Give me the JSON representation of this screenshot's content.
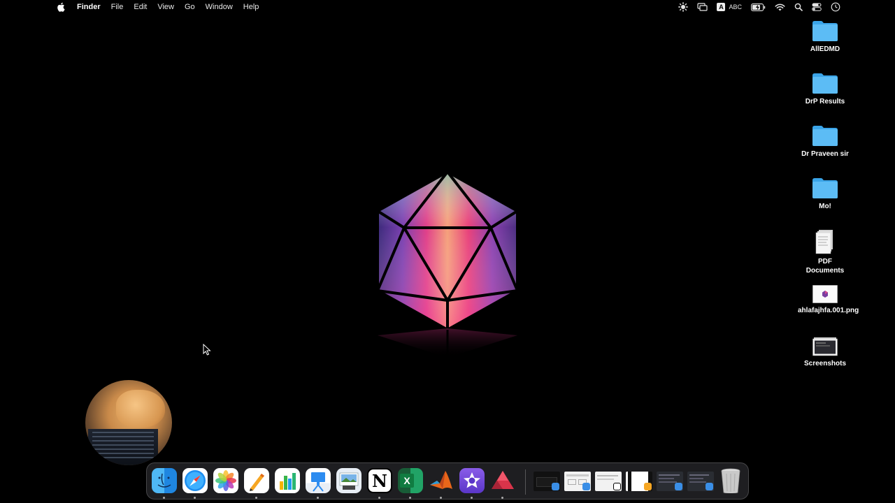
{
  "menubar": {
    "apple_icon": "apple-logo-icon",
    "app_name": "Finder",
    "items": [
      "File",
      "Edit",
      "View",
      "Go",
      "Window",
      "Help"
    ],
    "status": {
      "icons": [
        "brightness-icon",
        "screen-mirroring-icon",
        "input-source-icon",
        "battery-charging-icon",
        "wifi-icon",
        "spotlight-search-icon",
        "control-center-icon",
        "clock-icon"
      ],
      "input_letter": "A",
      "input_source": "ABC"
    }
  },
  "desktop": {
    "items": [
      {
        "label": "AllEDMD",
        "type": "folder"
      },
      {
        "label": "DrP Results",
        "type": "folder"
      },
      {
        "label": "Dr Praveen sir",
        "type": "folder"
      },
      {
        "label": "Mo!",
        "type": "folder"
      },
      {
        "label": "PDF Documents",
        "type": "document-stack"
      },
      {
        "label": "ahlafajhfa.001.png",
        "type": "image"
      },
      {
        "label": "Screenshots",
        "type": "screenshot-stack"
      }
    ]
  },
  "dock": {
    "apps": [
      {
        "name": "Finder",
        "icon": "finder-icon",
        "running": true
      },
      {
        "name": "Safari",
        "icon": "safari-icon",
        "running": true
      },
      {
        "name": "Photos",
        "icon": "photos-icon",
        "running": false
      },
      {
        "name": "Pages",
        "icon": "pages-icon",
        "running": true
      },
      {
        "name": "Numbers",
        "icon": "numbers-icon",
        "running": false
      },
      {
        "name": "Keynote",
        "icon": "keynote-icon",
        "running": true
      },
      {
        "name": "Preview",
        "icon": "preview-icon",
        "running": false
      },
      {
        "name": "Notion",
        "icon": "notion-icon",
        "running": true
      },
      {
        "name": "Microsoft Excel",
        "icon": "excel-icon",
        "running": true
      },
      {
        "name": "MATLAB",
        "icon": "matlab-icon",
        "running": true
      },
      {
        "name": "iMovie",
        "icon": "imovie-icon",
        "running": true
      },
      {
        "name": "Affinity",
        "icon": "affinity-icon",
        "running": true
      }
    ],
    "notion_letter": "N",
    "excel_letter": "X",
    "minimized_windows": [
      "minimized-window-1",
      "minimized-window-2",
      "minimized-window-3",
      "minimized-window-4",
      "minimized-window-5",
      "minimized-window-6"
    ],
    "trash_icon": "trash-icon"
  }
}
